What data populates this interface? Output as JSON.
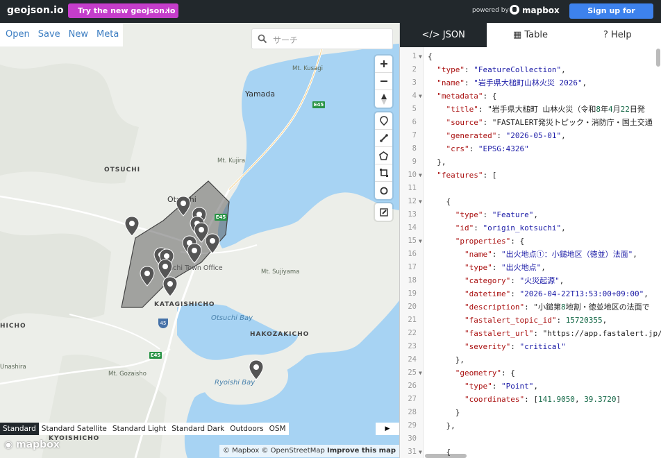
{
  "topbar": {
    "brand": "geojson.io",
    "try_new": "Try the new geojson.io",
    "powered_by": "powered by",
    "mapbox": "mapbox",
    "signup": "Sign up for Mapbox"
  },
  "menu": {
    "items": [
      "Open",
      "Save",
      "New",
      "Meta"
    ]
  },
  "search": {
    "placeholder": "サーチ"
  },
  "map_labels": {
    "mt_kusagi": "Mt. Kusagi",
    "yamada": "Yamada",
    "mt_kujira": "Mt. Kujira",
    "otsuchi_region": "OTSUCHI",
    "otsuchi_town": "Otsuchi",
    "town_office": "Otsuchi Town Office",
    "mt_sujiyama": "Mt. Sujiyama",
    "katagishicho": "KATAGISHICHO",
    "hichio": "HICHO",
    "otsuchi_bay": "Otsuchi Bay",
    "hakozakicho": "HAKOZAKICHO",
    "unashira": "Unashira",
    "mt_gozaisho": "Mt. Gozaisho",
    "ryoishi_bay": "Ryoishi Bay",
    "kyoishicho": "KYOISHICHO",
    "e45_a": "E45",
    "e45_b": "E45",
    "e45_c": "E45",
    "route45": "45"
  },
  "styles": {
    "items": [
      "Standard",
      "Standard Satellite",
      "Standard Light",
      "Standard Dark",
      "Outdoors",
      "OSM"
    ],
    "active": "Standard"
  },
  "attribution": {
    "mapbox": "© Mapbox",
    "osm": "© OpenStreetMap",
    "improve": "Improve this map",
    "watermark": "mapbox"
  },
  "panel": {
    "tabs": [
      {
        "label": "JSON",
        "icon": "code-icon",
        "active": true
      },
      {
        "label": "Table",
        "icon": "table-icon",
        "active": false
      },
      {
        "label": "Help",
        "icon": "question-icon",
        "active": false
      }
    ]
  },
  "code_lines": [
    "{",
    "  \"type\": \"FeatureCollection\",",
    "  \"name\": \"岩手県大槌町山林火災 2026\",",
    "  \"metadata\": {",
    "    \"title\": \"岩手県大槌町 山林火災（令和8年4月22日発",
    "    \"source\": \"FASTALERT発災トピック・消防庁・国土交通",
    "    \"generated\": \"2026-05-01\",",
    "    \"crs\": \"EPSG:4326\"",
    "  },",
    "  \"features\": [",
    "",
    "    {",
    "      \"type\": \"Feature\",",
    "      \"id\": \"origin_kotsuchi\",",
    "      \"properties\": {",
    "        \"name\": \"出火地点①：小鎚地区（徳並）法面\",",
    "        \"type\": \"出火地点\",",
    "        \"category\": \"火災起源\",",
    "        \"datetime\": \"2026-04-22T13:53:00+09:00\",",
    "        \"description\": \"小鎚第8地割・徳並地区の法面で",
    "        \"fastalert_topic_id\": 15720355,",
    "        \"fastalert_url\": \"https://app.fastalert.jp/do",
    "        \"severity\": \"critical\"",
    "      },",
    "      \"geometry\": {",
    "        \"type\": \"Point\",",
    "        \"coordinates\": [141.9050, 39.3720]",
    "      }",
    "    },",
    "",
    "    {"
  ],
  "fold_lines": [
    1,
    4,
    10,
    12,
    15,
    25,
    31
  ],
  "colors": {
    "topbar": "#22282c",
    "try_button": "#c53dcb",
    "signup_button": "#3d82ed",
    "water": "#a7d3f3",
    "polygon_fill": "#555555"
  }
}
